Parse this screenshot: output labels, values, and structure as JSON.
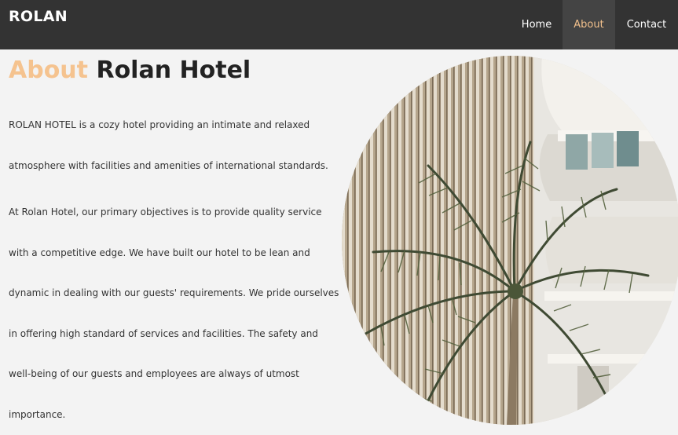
{
  "brand": "ROLAN",
  "nav": {
    "home": "Home",
    "about": "About",
    "contact": "Contact"
  },
  "heading": {
    "accent": "About",
    "rest": "Rolan Hotel"
  },
  "paragraphs": [
    "ROLAN HOTEL is a cozy hotel providing an intimate and relaxed atmosphere with facilities and amenities of international standards.",
    "At Rolan Hotel, our primary objectives is to provide quality service with a competitive edge. We have built our hotel to be lean and dynamic in dealing with our guests' requirements. We pride ourselves in offering high standard of services and facilities. The safety and well-being of our guests and employees are always of utmost importance."
  ],
  "colors": {
    "navbar": "#333333",
    "accent": "#f5c38f",
    "background": "#f3f3f3"
  }
}
